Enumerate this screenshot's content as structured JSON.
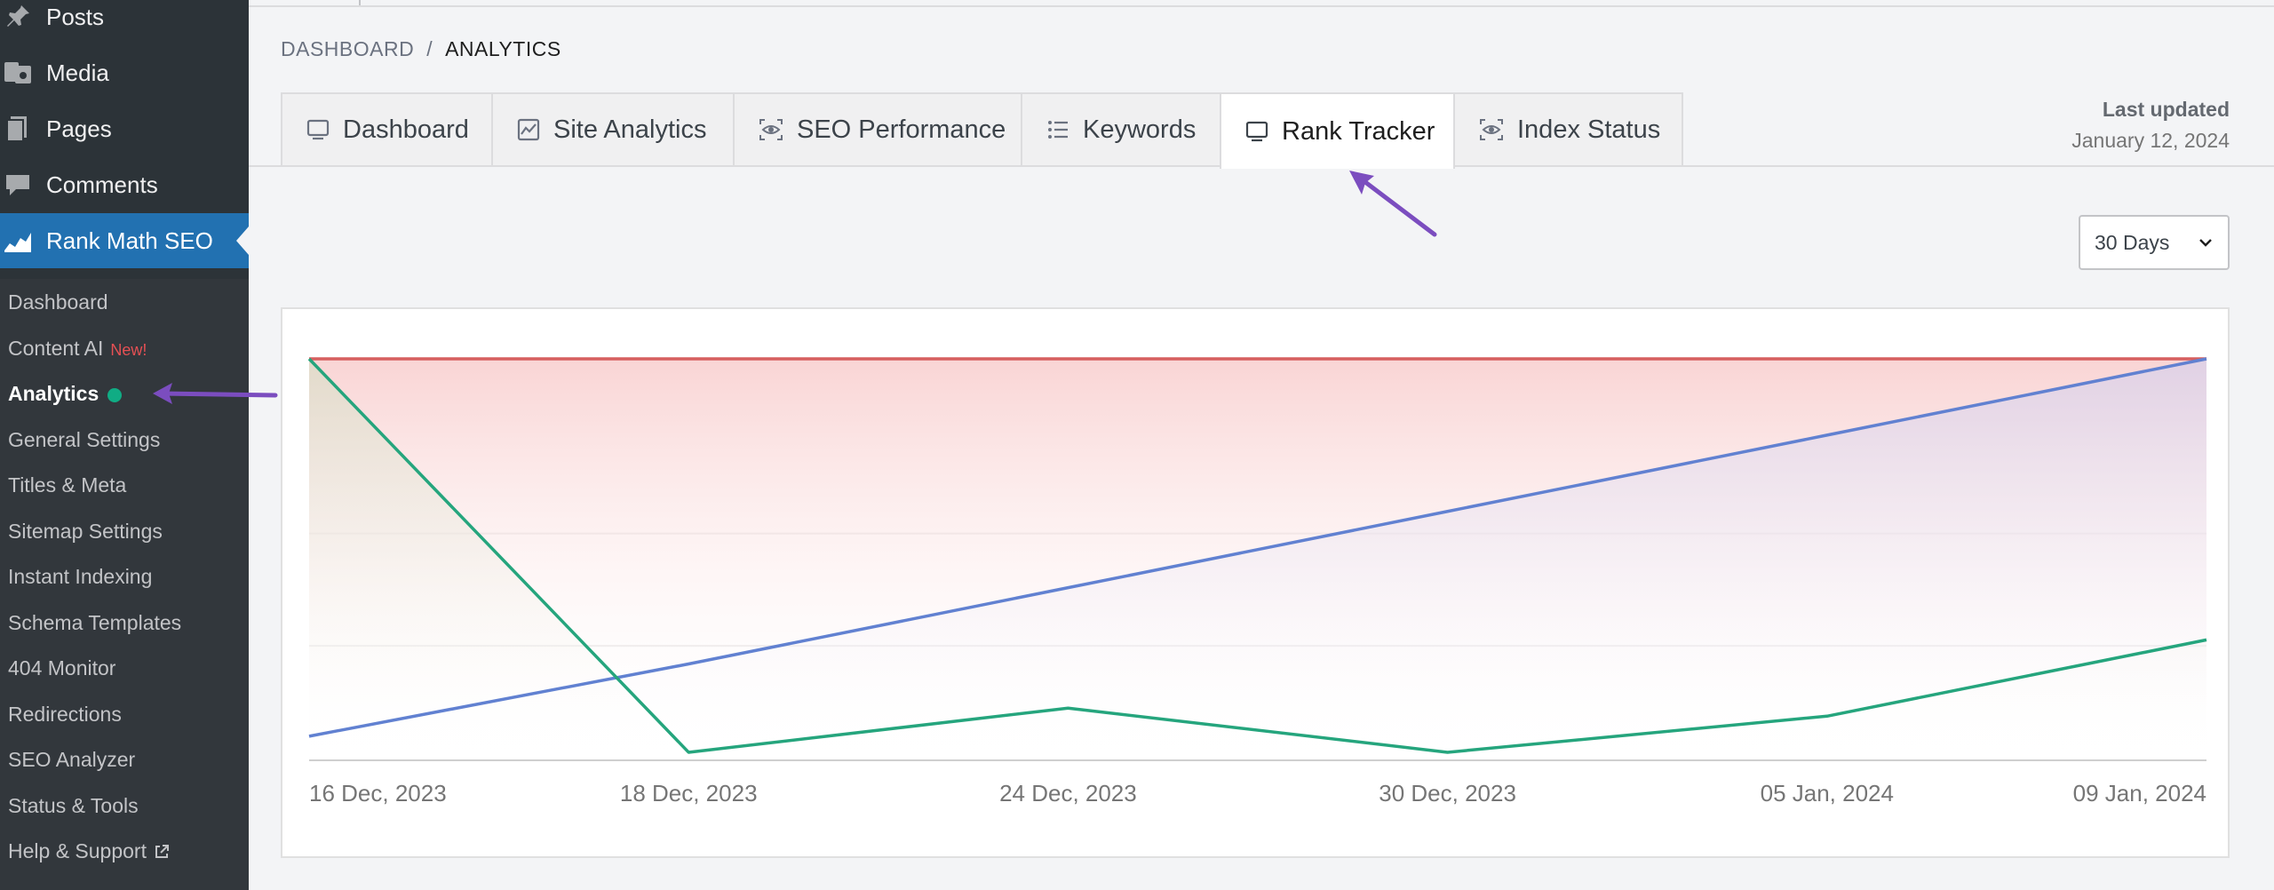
{
  "sidebar": {
    "top_items": [
      {
        "label": "Posts",
        "icon": "pin-icon"
      },
      {
        "label": "Media",
        "icon": "media-icon"
      },
      {
        "label": "Pages",
        "icon": "pages-icon"
      },
      {
        "label": "Comments",
        "icon": "comments-icon"
      }
    ],
    "active_item": {
      "label": "Rank Math SEO",
      "icon": "rank-math-icon"
    },
    "submenu": [
      {
        "label": "Dashboard"
      },
      {
        "label": "Content AI",
        "badge": "New!"
      },
      {
        "label": "Analytics"
      },
      {
        "label": "General Settings"
      },
      {
        "label": "Titles & Meta"
      },
      {
        "label": "Sitemap Settings"
      },
      {
        "label": "Instant Indexing"
      },
      {
        "label": "Schema Templates"
      },
      {
        "label": "404 Monitor"
      },
      {
        "label": "Redirections"
      },
      {
        "label": "SEO Analyzer"
      },
      {
        "label": "Status & Tools"
      },
      {
        "label": "Help & Support"
      }
    ]
  },
  "breadcrumb": {
    "parent": "DASHBOARD",
    "separator": "/",
    "current": "ANALYTICS"
  },
  "tabs": [
    {
      "label": "Dashboard",
      "icon": "monitor-icon"
    },
    {
      "label": "Site Analytics",
      "icon": "line-chart-icon"
    },
    {
      "label": "SEO Performance",
      "icon": "eye-scan-icon"
    },
    {
      "label": "Keywords",
      "icon": "list-icon"
    },
    {
      "label": "Rank Tracker",
      "icon": "monitor-icon",
      "active": true
    },
    {
      "label": "Index Status",
      "icon": "eye-scan-icon"
    }
  ],
  "last_updated": {
    "label": "Last updated",
    "date": "January 12, 2024"
  },
  "range_select": {
    "value": "30 Days"
  },
  "colors": {
    "accent": "#2271b1",
    "red": "#d65f5f",
    "blue": "#6181d1",
    "green": "#25a57d",
    "arrow": "#7b4dbf"
  },
  "chart_data": {
    "type": "line",
    "x_labels": [
      "16 Dec, 2023",
      "18 Dec, 2023",
      "24 Dec, 2023",
      "30 Dec, 2023",
      "05 Jan, 2024",
      "09 Jan, 2024"
    ],
    "ylim": [
      0,
      100
    ],
    "grid": true,
    "series": [
      {
        "color": "#d65f5f",
        "values": [
          100,
          100,
          100,
          100,
          100,
          100
        ]
      },
      {
        "color": "#6181d1",
        "values": [
          6,
          24,
          43,
          62,
          81,
          100
        ]
      },
      {
        "color": "#25a57d",
        "values": [
          100,
          2,
          13,
          2,
          11,
          30
        ]
      }
    ]
  }
}
